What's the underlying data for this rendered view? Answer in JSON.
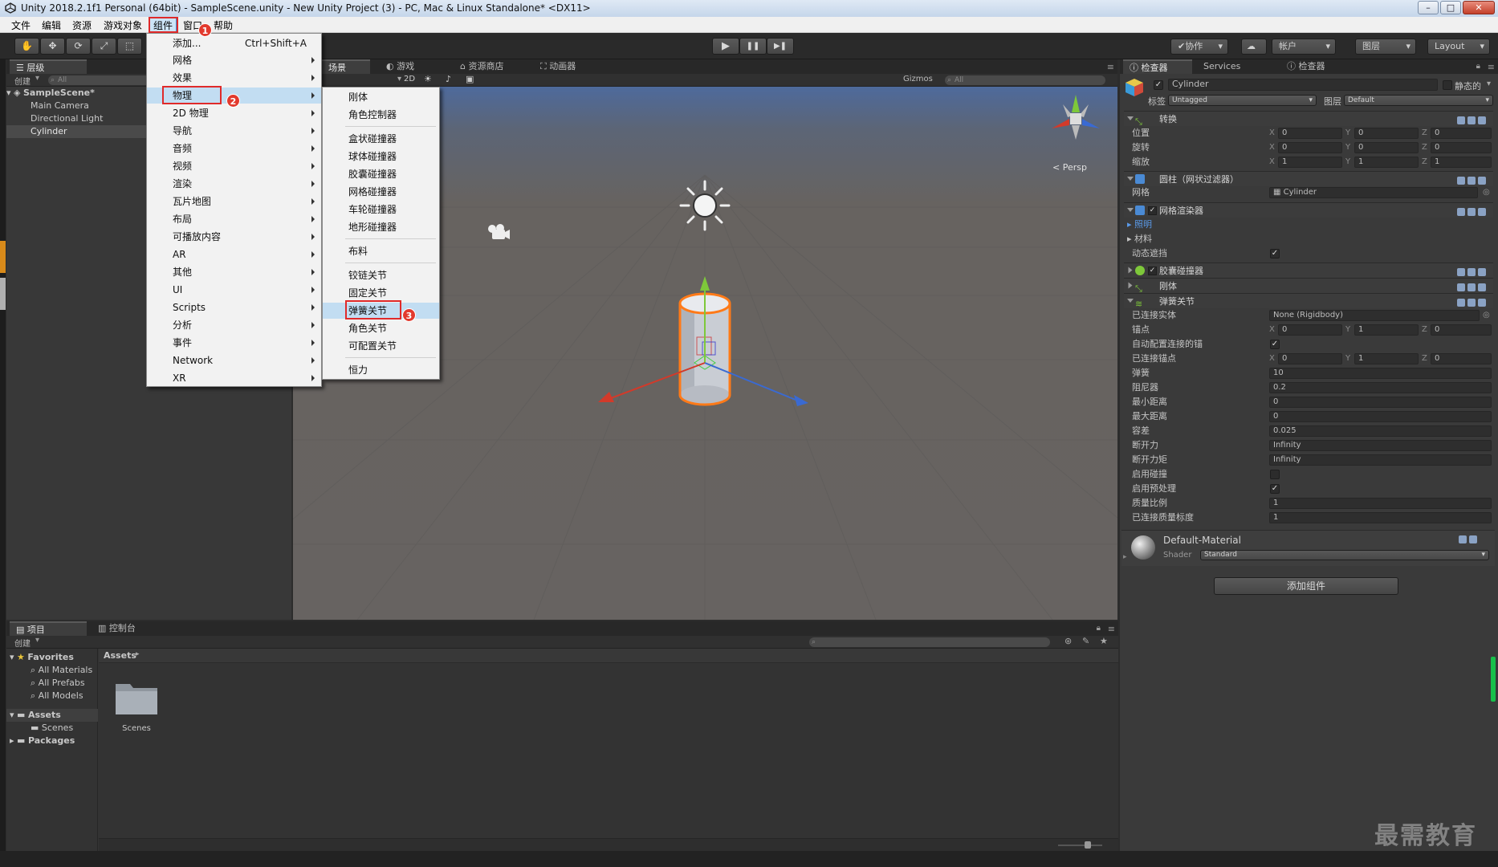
{
  "window": {
    "title": "Unity 2018.2.1f1 Personal (64bit) - SampleScene.unity - New Unity Project (3) - PC, Mac & Linux Standalone* <DX11>",
    "minimize": "–",
    "maximize": "□",
    "close": "✕"
  },
  "menubar": {
    "items": [
      "文件",
      "编辑",
      "资源",
      "游戏对象",
      "组件",
      "窗口",
      "帮助"
    ]
  },
  "toolbar": {
    "collab": "✔协作",
    "account": "帐户",
    "layers": "图层",
    "layout": "Layout",
    "play": "▶",
    "pause": "❚❚",
    "step": "▶❚"
  },
  "hierarchy": {
    "tab": "层级",
    "create": "创建",
    "search_placeholder": "All",
    "scene": "SampleScene*",
    "items": [
      "Main Camera",
      "Directional Light",
      "Cylinder"
    ]
  },
  "scene_view": {
    "tabs": [
      "场景",
      "游戏",
      "资源商店",
      "动画器"
    ],
    "mode_2d": "2D",
    "gizmos": "Gizmos",
    "search_placeholder": "All",
    "persp_label": "Persp"
  },
  "component_menu": {
    "items": [
      {
        "label": "添加...",
        "shortcut": "Ctrl+Shift+A"
      },
      {
        "label": "网格"
      },
      {
        "label": "效果"
      },
      {
        "label": "物理"
      },
      {
        "label": "2D 物理"
      },
      {
        "label": "导航"
      },
      {
        "label": "音频"
      },
      {
        "label": "视频"
      },
      {
        "label": "渲染"
      },
      {
        "label": "瓦片地图"
      },
      {
        "label": "布局"
      },
      {
        "label": "可播放内容"
      },
      {
        "label": "AR"
      },
      {
        "label": "其他"
      },
      {
        "label": "UI"
      },
      {
        "label": "Scripts"
      },
      {
        "label": "分析"
      },
      {
        "label": "事件"
      },
      {
        "label": "Network"
      },
      {
        "label": "XR"
      }
    ]
  },
  "physics_menu": {
    "items": [
      "刚体",
      "角色控制器",
      "盒状碰撞器",
      "球体碰撞器",
      "胶囊碰撞器",
      "网格碰撞器",
      "车轮碰撞器",
      "地形碰撞器",
      "布料",
      "铰链关节",
      "固定关节",
      "弹簧关节",
      "角色关节",
      "可配置关节",
      "恒力"
    ]
  },
  "badges": [
    "1",
    "2",
    "3"
  ],
  "inspector": {
    "tabs": [
      "检查器",
      "Services",
      "检查器"
    ],
    "object_name": "Cylinder",
    "static_label": "静态的",
    "tag_label": "标签",
    "tag_value": "Untagged",
    "layer_label": "图层",
    "layer_value": "Default",
    "transform": {
      "title": "转换",
      "position_label": "位置",
      "rotation_label": "旋转",
      "scale_label": "缩放",
      "position": [
        "0",
        "0",
        "0"
      ],
      "rotation": [
        "0",
        "0",
        "0"
      ],
      "scale": [
        "1",
        "1",
        "1"
      ]
    },
    "mesh_filter": {
      "title": "圆柱（网状过滤器）",
      "mesh_label": "网格",
      "mesh_value": "Cylinder"
    },
    "mesh_renderer": {
      "title": "网格渲染器",
      "lighting": "照明",
      "materials": "材料",
      "dynamic_occluded": "动态遮挡"
    },
    "capsule_collider": {
      "title": "胶囊碰撞器"
    },
    "rigidbody": {
      "title": "刚体"
    },
    "spring_joint": {
      "title": "弹簧关节",
      "connected_body_label": "已连接实体",
      "connected_body_value": "None (Rigidbody)",
      "anchor_label": "锚点",
      "anchor": [
        "0",
        "1",
        "0"
      ],
      "auto_config_label": "自动配置连接的锚",
      "connected_anchor_label": "已连接锚点",
      "connected_anchor": [
        "0",
        "1",
        "0"
      ],
      "spring_label": "弹簧",
      "spring_value": "10",
      "damper_label": "阻尼器",
      "damper_value": "0.2",
      "min_distance_label": "最小距离",
      "min_distance_value": "0",
      "max_distance_label": "最大距离",
      "max_distance_value": "0",
      "tolerance_label": "容差",
      "tolerance_value": "0.025",
      "break_force_label": "断开力",
      "break_force_value": "Infinity",
      "break_torque_label": "断开力矩",
      "break_torque_value": "Infinity",
      "enable_collision_label": "启用碰撞",
      "enable_preprocessing_label": "启用预处理",
      "mass_scale_label": "质量比例",
      "mass_scale_value": "1",
      "connected_mass_scale_label": "已连接质量标度",
      "connected_mass_scale_value": "1"
    },
    "material": {
      "name": "Default-Material",
      "shader_label": "Shader",
      "shader_value": "Standard"
    },
    "add_component": "添加组件"
  },
  "project": {
    "tabs": [
      "项目",
      "控制台"
    ],
    "create": "创建",
    "favorites": "Favorites",
    "fav_items": [
      "All Materials",
      "All Prefabs",
      "All Models"
    ],
    "assets": "Assets",
    "asset_children": [
      "Scenes"
    ],
    "packages": "Packages",
    "breadcrumb": "Assets",
    "folder_label": "Scenes"
  },
  "watermark": "最需教育",
  "axis_labels": [
    "X",
    "Y",
    "Z"
  ]
}
